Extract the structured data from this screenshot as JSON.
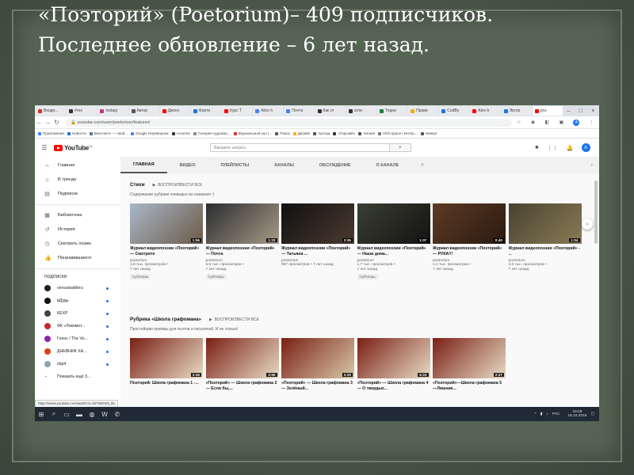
{
  "slide": {
    "title": "«Поэторий» (Poetorium)– 409 подписчиков. Последнее обновление – 6 лет назад."
  },
  "browser": {
    "tabs": [
      {
        "label": "Входя...",
        "color": "#d93025"
      },
      {
        "label": "#гек",
        "color": "#333333"
      },
      {
        "label": "Instagr",
        "color": "#c13584"
      },
      {
        "label": "Автор",
        "color": "#555555"
      },
      {
        "label": "Джонс",
        "color": "#ff0000"
      },
      {
        "label": "Фарти",
        "color": "#1a73e8"
      },
      {
        "label": "Курс Т",
        "color": "#ff0000"
      },
      {
        "label": "Alice h",
        "color": "#4285f4"
      },
      {
        "label": "Почта",
        "color": "#4285f4"
      },
      {
        "label": "Как от",
        "color": "#333333"
      },
      {
        "label": "сити",
        "color": "#333333"
      },
      {
        "label": "Терри",
        "color": "#188038"
      },
      {
        "label": "Прави",
        "color": "#f9ab00"
      },
      {
        "label": "CodBy",
        "color": "#1a73e8"
      },
      {
        "label": "Alex b",
        "color": "#ff0000"
      },
      {
        "label": "Экспр",
        "color": "#1a73e8"
      },
      {
        "label": "роз",
        "color": "#ff0000",
        "active": true
      }
    ],
    "url": "youtube.com/user/poetorium/featured",
    "bookmarks": [
      {
        "label": "Приложения",
        "color": "#4285f4"
      },
      {
        "label": "Новости",
        "color": "#1a73e8"
      },
      {
        "label": "Вконтакте — свой...",
        "color": "#4c75a3"
      },
      {
        "label": "Google Переводчик",
        "color": "#4285f4"
      },
      {
        "label": "Асоитис",
        "color": "#333333"
      },
      {
        "label": "Галерея художни...",
        "color": "#888888"
      },
      {
        "label": "Журнальный зал |...",
        "color": "#d93025"
      },
      {
        "label": "Поиск",
        "color": "#555555"
      },
      {
        "label": "Дизайн",
        "color": "#f9ab00"
      },
      {
        "label": "Артхад",
        "color": "#555555"
      },
      {
        "label": "«Горький»",
        "color": "#333333"
      },
      {
        "label": "Чигаев",
        "color": "#555555"
      },
      {
        "label": "Нfch.space | Интер...",
        "color": "#777777"
      },
      {
        "label": "Неверт",
        "color": "#555555"
      }
    ],
    "status_url": "https://www.youtube.com/watch?v=hZT58G03_Bc"
  },
  "youtube": {
    "logo": "YouTube",
    "logo_region": "RU",
    "search_placeholder": "Введите запрос",
    "avatar_letter": "А",
    "sidebar": {
      "main": [
        {
          "label": "Главная",
          "icon": "home-icon",
          "glyph": "⌂"
        },
        {
          "label": "В тренде",
          "icon": "trending-icon",
          "glyph": "♨"
        },
        {
          "label": "Подписки",
          "icon": "subscriptions-icon",
          "glyph": "▤"
        }
      ],
      "library": [
        {
          "label": "Библиотека",
          "icon": "library-icon",
          "glyph": "▦"
        },
        {
          "label": "История",
          "icon": "history-icon",
          "glyph": "↺"
        },
        {
          "label": "Смотреть позже",
          "icon": "watch-later-icon",
          "glyph": "◷"
        },
        {
          "label": "Понравившиеся",
          "icon": "like-icon",
          "glyph": "👍"
        }
      ],
      "subscriptions_heading": "ПОДПИСКИ",
      "subscriptions": [
        {
          "label": "versusbattleru",
          "color": "#222222"
        },
        {
          "label": "вДудь",
          "color": "#111111"
        },
        {
          "label": "КЕХР",
          "color": "#444444"
        },
        {
          "label": "ФК «Локомот...",
          "color": "#c62828"
        },
        {
          "label": "Голос / The Vo...",
          "color": "#8e24aa"
        },
        {
          "label": "ДНЕВНИК ХА...",
          "color": "#d84315"
        },
        {
          "label": "sbp4",
          "color": "#90a4ae"
        }
      ],
      "show_more": "Показать ещё 3..."
    },
    "channel_tabs": [
      "ГЛАВНАЯ",
      "ВИДЕО",
      "ПЛЕЙЛИСТЫ",
      "КАНАЛЫ",
      "ОБСУЖДЕНИЕ",
      "О КАНАЛЕ"
    ],
    "shelf1": {
      "title": "Стихи",
      "play_all": "ВОСПРОИЗВЕСТИ ВСЕ",
      "description": "Содержание рубрики очевидно из названия :)",
      "videos": [
        {
          "title": "Журнал видеопоэзии «Поэторий» — Смотрите",
          "channel": "poetorium",
          "views": "1,8 тыс. просмотров •",
          "age": "7 лет назад",
          "badge": "Субтитры",
          "duration": "1:06",
          "c1": "#a8b7c9",
          "c2": "#6d5a48"
        },
        {
          "title": "Журнал видеопоэзии «Поэторий» — Почта",
          "channel": "poetorium",
          "views": "5,8 тыс. просмотров •",
          "age": "7 лет назад",
          "badge": "Субтитры",
          "duration": "1:23",
          "c1": "#2a2d31",
          "c2": "#a79a84"
        },
        {
          "title": "Журнал видеопоэзии «Поэторий» — Татьяна ...",
          "channel": "poetorium",
          "views": "967 просмотров • 7 лет назад",
          "age": "",
          "badge": "",
          "duration": "2:26",
          "c1": "#111111",
          "c2": "#4b3a2f"
        },
        {
          "title": "Журнал видеопоэзии «Поэторий» — Наши дома...",
          "channel": "poetorium",
          "views": "1,7 тыс. просмотров •",
          "age": "7 лет назад",
          "badge": "Субтитры",
          "duration": "1:07",
          "c1": "#3b3f32",
          "c2": "#131313"
        },
        {
          "title": "Журнал видеопоэзии «Поэторий» — РУКА!!!",
          "channel": "poetorium",
          "views": "1,4 тыс. просмотров •",
          "age": "7 лет назад",
          "badge": "",
          "duration": "0:40",
          "c1": "#5c3a25",
          "c2": "#2b1a10"
        },
        {
          "title": "Журнал видеопоэзии «Поэторий» - ...",
          "channel": "poetorium",
          "views": "2,6 тыс. просмотров •",
          "age": "7 лет назад",
          "badge": "",
          "duration": "1:04",
          "c1": "#47422f",
          "c2": "#8b7b55"
        }
      ]
    },
    "shelf2": {
      "title": "Рубрика «Школа графомана»",
      "play_all": "ВОСПРОИЗВЕСТИ ВСЕ",
      "description": "Простейшие приемы для поэтов и писателей. И не только!",
      "videos": [
        {
          "title": "Поэторий: Школа графомана 1 -...",
          "duration": "2:26",
          "c1": "#7a1f14",
          "c2": "#e8dcc5"
        },
        {
          "title": "«Поэторий» — Школа графомана 2 — Если бы,...",
          "duration": "3:50",
          "c1": "#7a1f14",
          "c2": "#e8dcc5"
        },
        {
          "title": "«Поэторий» — Школа графомана 3 — Зелёный...",
          "duration": "3:20",
          "c1": "#7a1f14",
          "c2": "#d8c8a8"
        },
        {
          "title": "«Поэторий» — Школа графомана 4 — О твердых...",
          "duration": "6:23",
          "c1": "#7a1f14",
          "c2": "#e8dcc5"
        },
        {
          "title": "«Поэторий»—Школа графомана 5—Лишние...",
          "duration": "2:27",
          "c1": "#7a1f14",
          "c2": "#e8dcc5"
        }
      ]
    }
  },
  "taskbar": {
    "lang": "РУС",
    "time": "16:09",
    "date": "18.10.2018"
  }
}
